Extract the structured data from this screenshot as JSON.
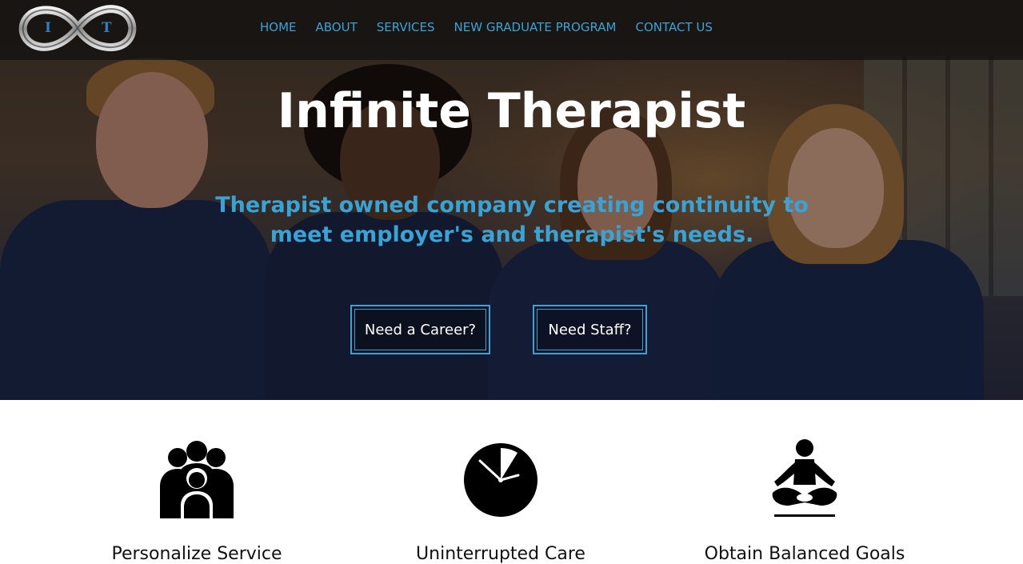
{
  "brand": {
    "logo_letters": [
      "I",
      "T"
    ],
    "accent_color": "#3aa3d6"
  },
  "nav": {
    "items": [
      "HOME",
      "ABOUT",
      "SERVICES",
      "NEW GRADUATE PROGRAM",
      "CONTACT US"
    ]
  },
  "hero": {
    "title": "Infinite Therapist",
    "tagline": "Therapist owned company creating continuity to meet employer's and therapist's needs.",
    "buttons": {
      "career": "Need a Career?",
      "staff": "Need Staff?"
    }
  },
  "features": [
    {
      "icon": "group-icon",
      "title": "Personalize Service"
    },
    {
      "icon": "clock-icon",
      "title": "Uninterrupted Care"
    },
    {
      "icon": "meditation-icon",
      "title": "Obtain Balanced Goals"
    }
  ]
}
